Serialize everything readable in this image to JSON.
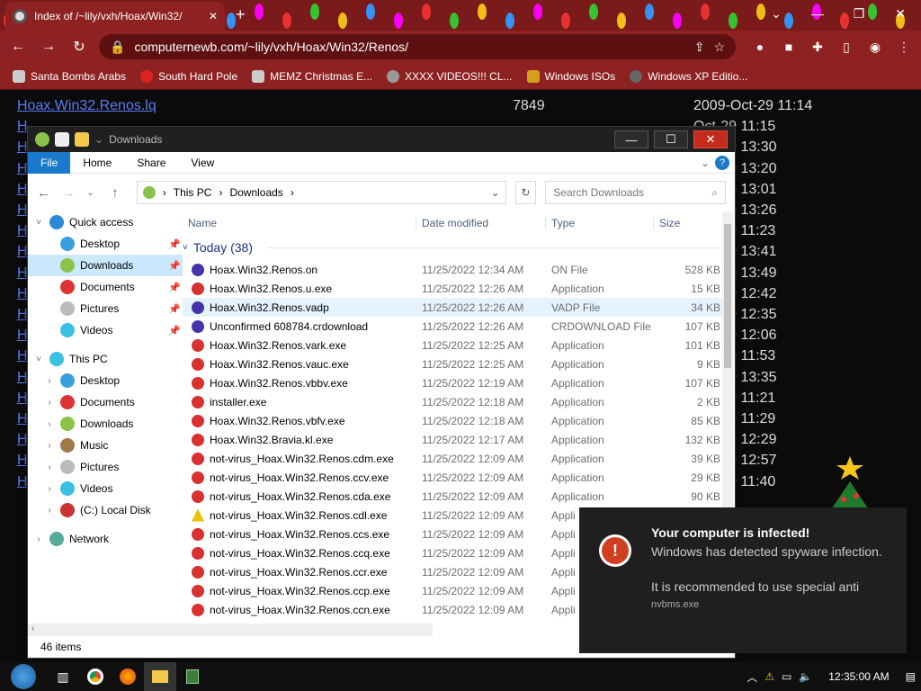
{
  "browser": {
    "tab_title": "Index of /~lily/vxh/Hoax/Win32/",
    "url": "computernewb.com/~lily/vxh/Hoax/Win32/Renos/",
    "bookmarks": [
      "Santa Bombs Arabs",
      "South Hard Pole",
      "MEMZ Christmas E...",
      "XXXX VIDEOS!!! CL...",
      "Windows ISOs",
      "Windows XP Editio..."
    ]
  },
  "page_rows": [
    {
      "name": "Hoax.Win32.Renos.lq",
      "size": "7849",
      "date": "2009-Oct-29 11:14"
    },
    {
      "name": "H",
      "size": "",
      "date": "Oct-29 11:15"
    },
    {
      "name": "H",
      "size": "",
      "date": "Oct-29 13:30"
    },
    {
      "name": "H",
      "size": "",
      "date": "Oct-29 13:20"
    },
    {
      "name": "H",
      "size": "",
      "date": "Oct-29 13:01"
    },
    {
      "name": "H",
      "size": "",
      "date": "Oct-29 13:26"
    },
    {
      "name": "H",
      "size": "",
      "date": "Oct-29 11:23"
    },
    {
      "name": "H",
      "size": "",
      "date": "Oct-29 13:41"
    },
    {
      "name": "H",
      "size": "",
      "date": "Oct-29 13:49"
    },
    {
      "name": "H",
      "size": "",
      "date": "Oct-29 12:42"
    },
    {
      "name": "H",
      "size": "",
      "date": "Oct-29 12:35"
    },
    {
      "name": "H",
      "size": "",
      "date": "Oct-29 12:06"
    },
    {
      "name": "H",
      "size": "",
      "date": "Oct-29 11:53"
    },
    {
      "name": "H",
      "size": "",
      "date": "Oct-29 13:35"
    },
    {
      "name": "H",
      "size": "",
      "date": "Oct-29 11:21"
    },
    {
      "name": "H",
      "size": "",
      "date": "Oct-29 11:29"
    },
    {
      "name": "H",
      "size": "",
      "date": "Oct-29 12:29"
    },
    {
      "name": "H",
      "size": "",
      "date": "Oct-29 12:57"
    },
    {
      "name": "H",
      "size": "",
      "date": "Oct-29 11:40"
    }
  ],
  "explorer": {
    "title": "Downloads",
    "ribbon": [
      "File",
      "Home",
      "Share",
      "View"
    ],
    "breadcrumb": [
      "This PC",
      "Downloads"
    ],
    "search_placeholder": "Search Downloads",
    "columns": [
      "Name",
      "Date modified",
      "Type",
      "Size"
    ],
    "group": "Today (38)",
    "status": "46 items",
    "nav": [
      {
        "label": "Quick access",
        "level": 0,
        "expand": "˅",
        "color": "#2a8ad4",
        "pin": false
      },
      {
        "label": "Desktop",
        "level": 1,
        "expand": "",
        "color": "#3a9fe0",
        "pin": true
      },
      {
        "label": "Downloads",
        "level": 1,
        "expand": "",
        "color": "#8bc34a",
        "pin": true,
        "selected": true
      },
      {
        "label": "Documents",
        "level": 1,
        "expand": "",
        "color": "#d33",
        "pin": true
      },
      {
        "label": "Pictures",
        "level": 1,
        "expand": "",
        "color": "#bbb",
        "pin": true
      },
      {
        "label": "Videos",
        "level": 1,
        "expand": "",
        "color": "#3ac0e0",
        "pin": true
      },
      {
        "label": "This PC",
        "level": 0,
        "expand": "˅",
        "color": "#3ac0e0",
        "pin": false
      },
      {
        "label": "Desktop",
        "level": 1,
        "expand": "›",
        "color": "#3a9fe0",
        "pin": false
      },
      {
        "label": "Documents",
        "level": 1,
        "expand": "›",
        "color": "#d33",
        "pin": false
      },
      {
        "label": "Downloads",
        "level": 1,
        "expand": "›",
        "color": "#8bc34a",
        "pin": false
      },
      {
        "label": "Music",
        "level": 1,
        "expand": "›",
        "color": "#a0784a",
        "pin": false
      },
      {
        "label": "Pictures",
        "level": 1,
        "expand": "›",
        "color": "#bbb",
        "pin": false
      },
      {
        "label": "Videos",
        "level": 1,
        "expand": "›",
        "color": "#3ac0e0",
        "pin": false
      },
      {
        "label": "(C:) Local Disk",
        "level": 1,
        "expand": "›",
        "color": "#c33",
        "pin": false
      },
      {
        "label": "Network",
        "level": 0,
        "expand": "›",
        "color": "#5a9",
        "pin": false
      }
    ],
    "files": [
      {
        "name": "Hoax.Win32.Renos.on",
        "date": "11/25/2022 12:34 AM",
        "type": "ON File",
        "size": "528 KB",
        "color": "#4433aa"
      },
      {
        "name": "Hoax.Win32.Renos.u.exe",
        "date": "11/25/2022 12:26 AM",
        "type": "Application",
        "size": "15 KB",
        "color": "#d93030"
      },
      {
        "name": "Hoax.Win32.Renos.vadp",
        "date": "11/25/2022 12:26 AM",
        "type": "VADP File",
        "size": "34 KB",
        "color": "#4433aa",
        "hl": true
      },
      {
        "name": "Unconfirmed 608784.crdownload",
        "date": "11/25/2022 12:26 AM",
        "type": "CRDOWNLOAD File",
        "size": "107 KB",
        "color": "#4433aa"
      },
      {
        "name": "Hoax.Win32.Renos.vark.exe",
        "date": "11/25/2022 12:25 AM",
        "type": "Application",
        "size": "101 KB",
        "color": "#d93030"
      },
      {
        "name": "Hoax.Win32.Renos.vauc.exe",
        "date": "11/25/2022 12:25 AM",
        "type": "Application",
        "size": "9 KB",
        "color": "#d93030"
      },
      {
        "name": "Hoax.Win32.Renos.vbbv.exe",
        "date": "11/25/2022 12:19 AM",
        "type": "Application",
        "size": "107 KB",
        "color": "#d93030"
      },
      {
        "name": "installer.exe",
        "date": "11/25/2022 12:18 AM",
        "type": "Application",
        "size": "2 KB",
        "color": "#d93030"
      },
      {
        "name": "Hoax.Win32.Renos.vbfv.exe",
        "date": "11/25/2022 12:18 AM",
        "type": "Application",
        "size": "85 KB",
        "color": "#d93030"
      },
      {
        "name": "Hoax.Win32.Bravia.kl.exe",
        "date": "11/25/2022 12:17 AM",
        "type": "Application",
        "size": "132 KB",
        "color": "#d93030"
      },
      {
        "name": "not-virus_Hoax.Win32.Renos.cdm.exe",
        "date": "11/25/2022 12:09 AM",
        "type": "Application",
        "size": "39 KB",
        "color": "#d93030"
      },
      {
        "name": "not-virus_Hoax.Win32.Renos.ccv.exe",
        "date": "11/25/2022 12:09 AM",
        "type": "Application",
        "size": "29 KB",
        "color": "#d93030"
      },
      {
        "name": "not-virus_Hoax.Win32.Renos.cda.exe",
        "date": "11/25/2022 12:09 AM",
        "type": "Application",
        "size": "90 KB",
        "color": "#d93030"
      },
      {
        "name": "not-virus_Hoax.Win32.Renos.cdl.exe",
        "date": "11/25/2022 12:09 AM",
        "type": "Appli",
        "size": "",
        "color": "#e6c200"
      },
      {
        "name": "not-virus_Hoax.Win32.Renos.ccs.exe",
        "date": "11/25/2022 12:09 AM",
        "type": "Appli",
        "size": "",
        "color": "#d93030"
      },
      {
        "name": "not-virus_Hoax.Win32.Renos.ccq.exe",
        "date": "11/25/2022 12:09 AM",
        "type": "Appli",
        "size": "",
        "color": "#d93030"
      },
      {
        "name": "not-virus_Hoax.Win32.Renos.ccr.exe",
        "date": "11/25/2022 12:09 AM",
        "type": "Appli",
        "size": "",
        "color": "#d93030"
      },
      {
        "name": "not-virus_Hoax.Win32.Renos.ccp.exe",
        "date": "11/25/2022 12:09 AM",
        "type": "Appli",
        "size": "",
        "color": "#d93030"
      },
      {
        "name": "not-virus_Hoax.Win32.Renos.ccn.exe",
        "date": "11/25/2022 12:09 AM",
        "type": "Appli",
        "size": "",
        "color": "#d93030"
      }
    ]
  },
  "toast": {
    "title": "Your computer is infected!",
    "body": "Windows has detected spyware infection.",
    "body2": "It is recommended to use special anti",
    "source": "nvbms.exe"
  },
  "taskbar": {
    "clock": "12:35:00 AM"
  }
}
